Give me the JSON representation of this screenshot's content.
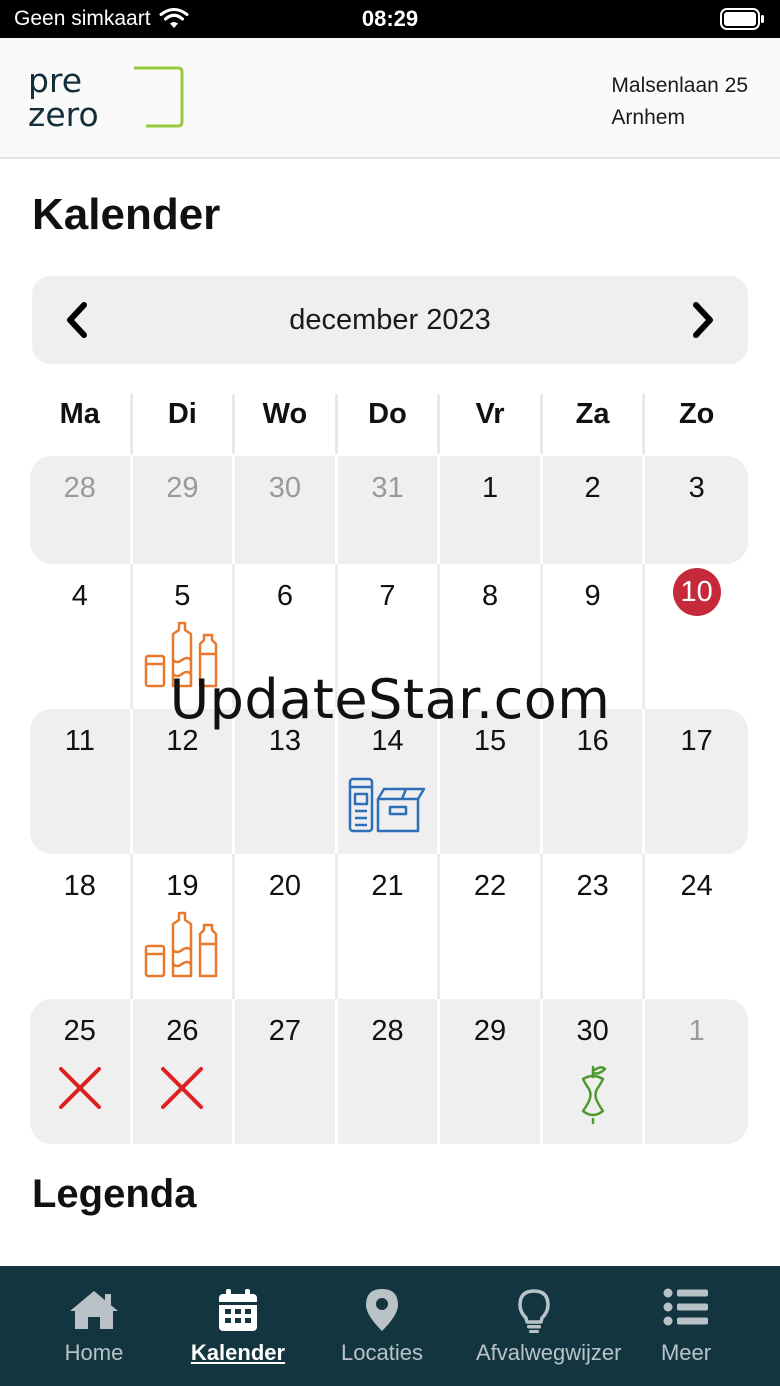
{
  "status_bar": {
    "carrier": "Geen simkaart",
    "time": "08:29"
  },
  "header": {
    "address_line1": "Malsenlaan 25",
    "address_line2": "Arnhem",
    "logo_line1": "pre",
    "logo_line2": "zero"
  },
  "page_title": "Kalender",
  "calendar": {
    "month_label": "december 2023",
    "weekdays": [
      "Ma",
      "Di",
      "Wo",
      "Do",
      "Vr",
      "Za",
      "Zo"
    ],
    "weeks": [
      [
        "28",
        "29",
        "30",
        "31",
        "1",
        "2",
        "3"
      ],
      [
        "4",
        "5",
        "6",
        "7",
        "8",
        "9",
        "10"
      ],
      [
        "11",
        "12",
        "13",
        "14",
        "15",
        "16",
        "17"
      ],
      [
        "18",
        "19",
        "20",
        "21",
        "22",
        "23",
        "24"
      ],
      [
        "25",
        "26",
        "27",
        "28",
        "29",
        "30",
        "1"
      ]
    ],
    "today": "10",
    "colors": {
      "plastic": "#e9782a",
      "paper": "#2f6fb7",
      "organic": "#4f9a2e",
      "cancelled": "#e02020",
      "today": "#c62a3a"
    }
  },
  "legend_title": "Legenda",
  "watermark": "UpdateStar.com",
  "tabbar": {
    "items": [
      {
        "label": "Home",
        "icon": "home-icon"
      },
      {
        "label": "Kalender",
        "icon": "calendar-icon"
      },
      {
        "label": "Locaties",
        "icon": "location-pin-icon"
      },
      {
        "label": "Afvalwegwijzer",
        "icon": "lightbulb-icon"
      },
      {
        "label": "Meer",
        "icon": "list-icon"
      }
    ]
  }
}
